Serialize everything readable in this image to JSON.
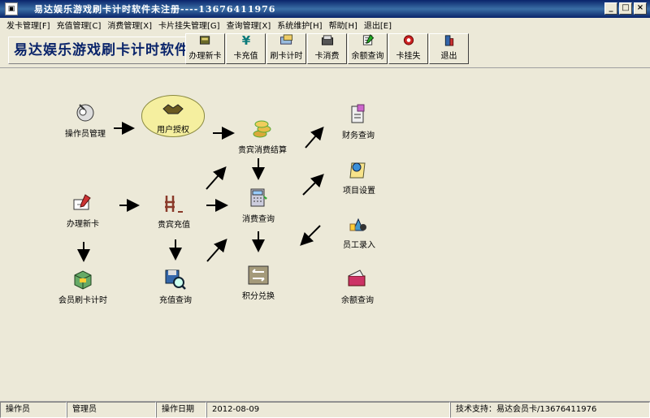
{
  "window": {
    "title": "易达娱乐游戏刷卡计时软件未注册----13676411976"
  },
  "menu": [
    "发卡管理[F]",
    "充值管理[C]",
    "消费管理[X]",
    "卡片挂失管理[G]",
    "查询管理[X]",
    "系统维护[H]",
    "帮助[H]",
    "退出[E]"
  ],
  "banner": {
    "text": "易达娱乐游戏刷卡计时软件"
  },
  "toolbar": [
    {
      "label": "办理新卡",
      "icon": "new-card-icon"
    },
    {
      "label": "卡充值",
      "icon": "yen-icon"
    },
    {
      "label": "刷卡计时",
      "icon": "card-swipe-icon"
    },
    {
      "label": "卡消费",
      "icon": "card-consume-icon"
    },
    {
      "label": "余额查询",
      "icon": "balance-query-icon"
    },
    {
      "label": "卡挂失",
      "icon": "card-lost-icon"
    },
    {
      "label": "退出",
      "icon": "exit-icon"
    }
  ],
  "nodes": {
    "operator": "操作员管理",
    "authorize": "用户授权",
    "settlement": "贵宾消费结算",
    "finance": "财务查询",
    "project": "项目设置",
    "newcard": "办理新卡",
    "recharge": "贵宾充值",
    "consume_query": "消费查询",
    "staff": "员工录入",
    "swipe": "会员刷卡计时",
    "recharge_query": "充值查询",
    "points": "积分兑换",
    "balance": "余额查询"
  },
  "status": {
    "operator_label": "操作员",
    "operator_value": "管理员",
    "date_label": "操作日期",
    "date_value": "2012-08-09",
    "support": "技术支持：易达会员卡/13676411976"
  },
  "colors": {
    "title_bar": "#0a246a",
    "background": "#ece9d8",
    "highlight": "#f5ef9f"
  }
}
